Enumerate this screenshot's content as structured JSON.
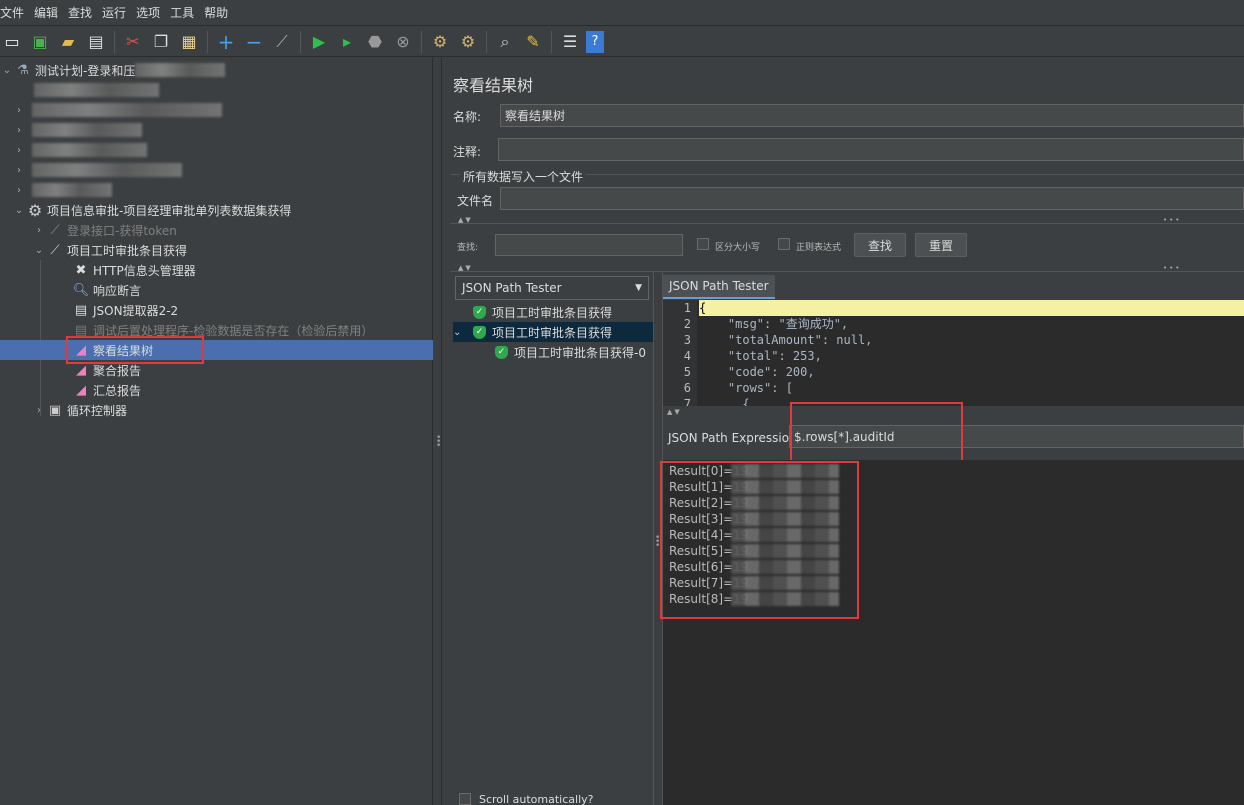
{
  "menu": [
    "文件",
    "编辑",
    "查找",
    "运行",
    "选项",
    "工具",
    "帮助"
  ],
  "toolbar_icons": [
    "new-icon",
    "templates-icon",
    "open-icon",
    "save-icon",
    "cut-icon",
    "copy-icon",
    "paste-icon",
    "expand-icon",
    "collapse-icon",
    "toggle-icon",
    "start-icon",
    "start-no-pause-icon",
    "stop-icon",
    "shutdown-icon",
    "clear-icon",
    "clear-all-icon",
    "search-icon",
    "reset-search-icon",
    "function-helper-icon",
    "help-icon"
  ],
  "tree": {
    "root_label": "测试计划-登录和压",
    "group_label": "项目信息审批-项目经理审批单列表数据集获得",
    "login_label": "登录接口-获得token",
    "sampler_label": "项目工时审批条目获得",
    "header_manager": "HTTP信息头管理器",
    "assertion": "响应断言",
    "json_extractor": "JSON提取器2-2",
    "debug_post": "调试后置处理程序-检验数据是否存在（检验后禁用）",
    "view_results": "察看结果树",
    "aggregate_report": "聚合报告",
    "summary_report": "汇总报告",
    "loop_controller": "循环控制器"
  },
  "panel": {
    "title": "察看结果树",
    "name_label": "名称:",
    "name_value": "察看结果树",
    "comment_label": "注释:",
    "comment_value": "",
    "write_all_label": "所有数据写入一个文件",
    "filename_label": "文件名",
    "filename_value": "",
    "search_label": "查找:",
    "search_value": "",
    "case_sensitive": "区分大小写",
    "regex": "正则表达式",
    "find_btn": "查找",
    "reset_btn": "重置",
    "renderer": "JSON Path Tester",
    "results_tree": [
      "项目工时审批条目获得",
      "项目工时审批条目获得",
      "项目工时审批条目获得-0"
    ],
    "tab_label": "JSON Path Tester",
    "json_lines": [
      "{",
      "    \"msg\": \"查询成功\",",
      "    \"totalAmount\": null,",
      "    \"total\": 253,",
      "    \"code\": 200,",
      "    \"rows\": [",
      "      {"
    ],
    "line_numbers": [
      "1",
      "2",
      "3",
      "4",
      "5",
      "6",
      "7"
    ],
    "expr_label": "JSON Path Expression",
    "expr_value": "$.rows[*].auditId",
    "results": [
      "Result[0]=19",
      "Result[1]=19",
      "Result[2]=19",
      "Result[3]=19",
      "Result[4]=19",
      "Result[5]=19",
      "Result[6]=19",
      "Result[7]=19",
      "Result[8]=19"
    ],
    "scroll_auto": "Scroll automatically?"
  },
  "colors": {
    "selection": "#4b6eaf",
    "highlight_box": "#e0393e",
    "pass": "#2fa84f"
  }
}
